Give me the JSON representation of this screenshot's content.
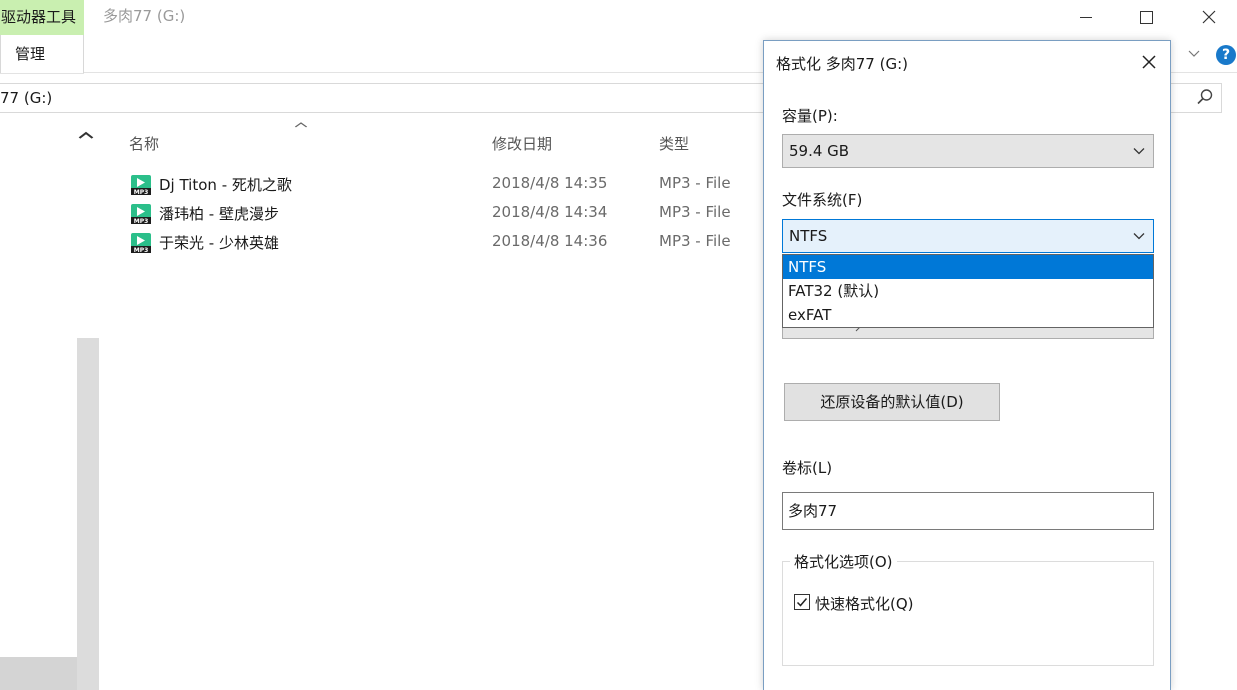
{
  "explorer": {
    "context_tab_label": "驱动器工具",
    "manage_label": "管理",
    "window_title": "多肉77 (G:)",
    "address_text": "77 (G:)",
    "columns": {
      "name": "名称",
      "date": "修改日期",
      "type": "类型"
    },
    "files": [
      {
        "name": "Dj Titon - 死机之歌",
        "date": "2018/4/8 14:35",
        "type": "MP3 - File"
      },
      {
        "name": "潘玮柏 - 壁虎漫步",
        "date": "2018/4/8 14:34",
        "type": "MP3 - File"
      },
      {
        "name": "于荣光 - 少林英雄",
        "date": "2018/4/8 14:36",
        "type": "MP3 - File"
      }
    ],
    "help_glyph": "?"
  },
  "dialog": {
    "title": "格式化 多肉77 (G:)",
    "capacity_label": "容量(P):",
    "capacity_value": "59.4 GB",
    "filesystem_label": "文件系统(F)",
    "filesystem_value": "NTFS",
    "filesystem_options": [
      "NTFS",
      "FAT32 (默认)",
      "exFAT"
    ],
    "selected_option_index": 0,
    "restore_button_label": "还原设备的默认值(D)",
    "volume_label_label": "卷标(L)",
    "volume_label_value": "多肉77",
    "options_group_label": "格式化选项(O)",
    "quick_format_label": "快速格式化(Q)",
    "quick_format_checked": true
  },
  "colors": {
    "context_tab": "#c9efb0",
    "selection": "#0078d7",
    "mp3_icon": "#2bbf8a"
  }
}
